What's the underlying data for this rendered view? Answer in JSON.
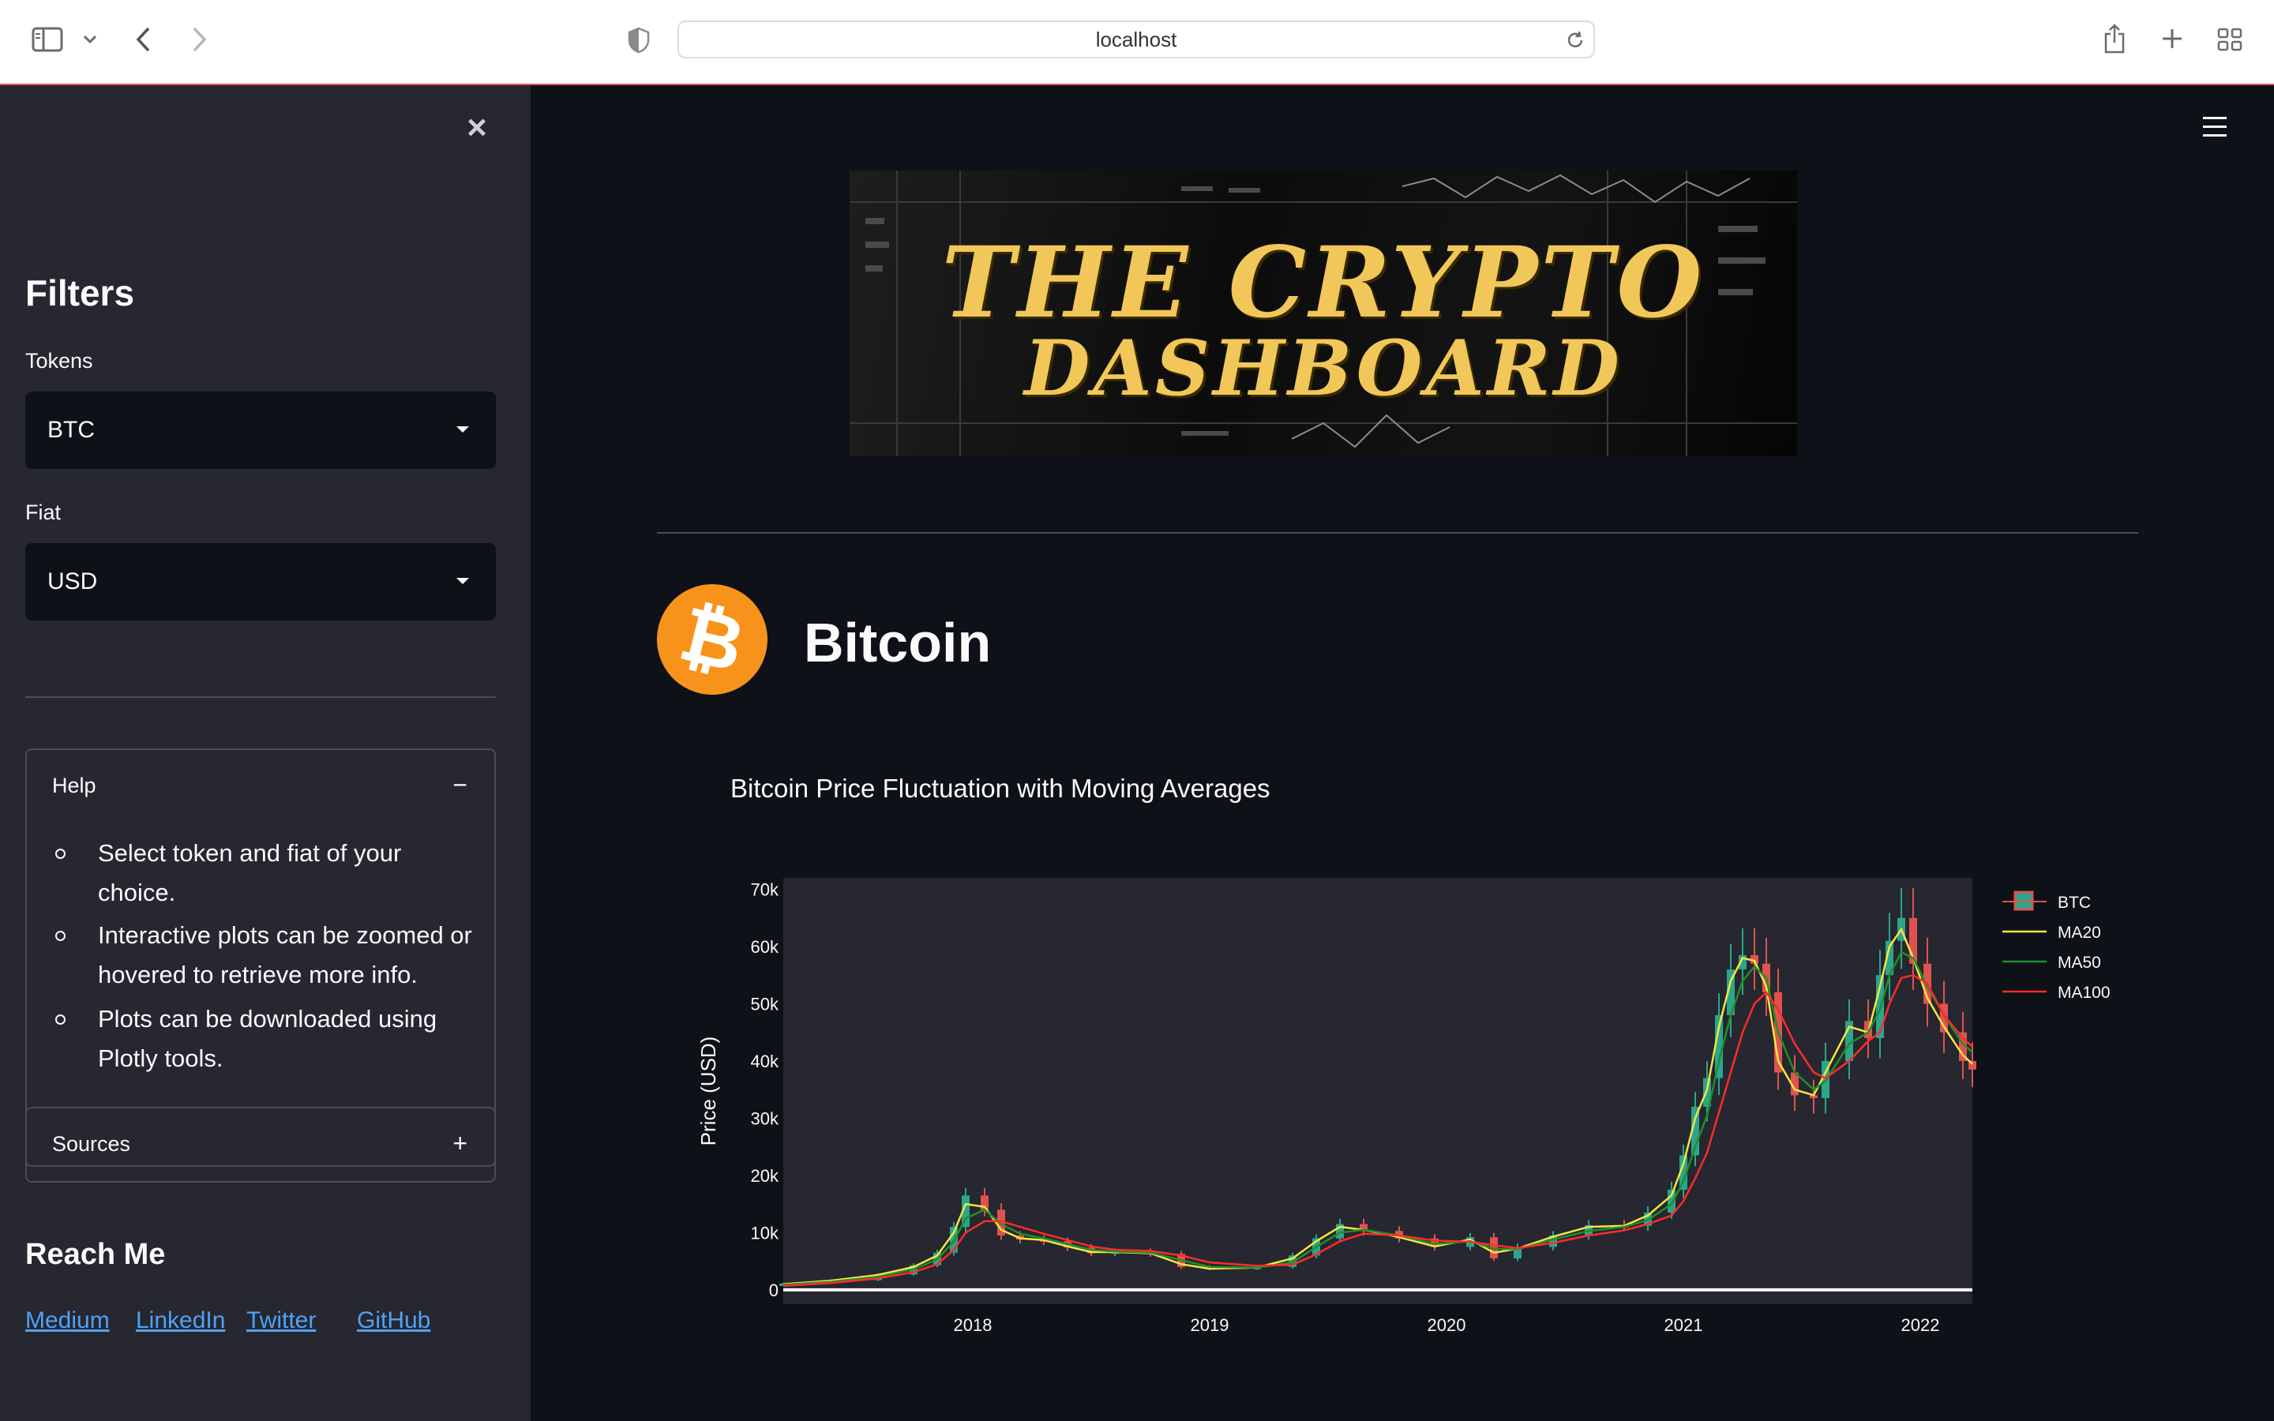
{
  "browser": {
    "url": "localhost"
  },
  "sidebar": {
    "filters_heading": "Filters",
    "tokens_label": "Tokens",
    "tokens_value": "BTC",
    "fiat_label": "Fiat",
    "fiat_value": "USD",
    "help": {
      "title": "Help",
      "toggle": "−",
      "items": [
        "Select token and fiat of your choice.",
        "Interactive plots can be zoomed or hovered to retrieve more info.",
        "Plots can be downloaded using Plotly tools."
      ]
    },
    "sources": {
      "title": "Sources",
      "toggle": "+"
    },
    "reach_heading": "Reach Me",
    "links": [
      "Medium",
      "LinkedIn",
      "Twitter",
      "GitHub"
    ]
  },
  "main": {
    "banner_line1": "THE CRYPTO",
    "banner_line2": "DASHBOARD",
    "coin_symbol": "₿",
    "coin_name": "Bitcoin",
    "chart_title": "Bitcoin Price Fluctuation with Moving Averages"
  },
  "colors": {
    "background": "#0e1117",
    "sidebar": "#262730",
    "plot_bg": "#262730",
    "accent_link": "#4fa2f7",
    "bitcoin_orange": "#f7931a",
    "ma20": "#f5e642",
    "ma50": "#1f8f2a",
    "ma100": "#ff2b2b",
    "candle_up": "#2ca58d",
    "candle_down": "#e0524f"
  },
  "chart_data": {
    "type": "line",
    "title": "Bitcoin Price Fluctuation with Moving Averages",
    "xlabel": "",
    "ylabel": "Price (USD)",
    "x_ticks": [
      "2018",
      "2019",
      "2020",
      "2021",
      "2022"
    ],
    "y_ticks": [
      "0",
      "10k",
      "20k",
      "30k",
      "40k",
      "50k",
      "60k",
      "70k"
    ],
    "xlim": [
      2017.2,
      2022.22
    ],
    "ylim": [
      -2500,
      72000
    ],
    "grid": false,
    "legend": "right",
    "x": [
      2017.2,
      2017.4,
      2017.6,
      2017.75,
      2017.85,
      2017.92,
      2017.97,
      2018.05,
      2018.12,
      2018.2,
      2018.3,
      2018.4,
      2018.5,
      2018.6,
      2018.75,
      2018.88,
      2019.0,
      2019.2,
      2019.35,
      2019.45,
      2019.55,
      2019.65,
      2019.8,
      2019.95,
      2020.1,
      2020.2,
      2020.3,
      2020.45,
      2020.6,
      2020.75,
      2020.85,
      2020.95,
      2021.0,
      2021.05,
      2021.1,
      2021.15,
      2021.2,
      2021.25,
      2021.3,
      2021.35,
      2021.4,
      2021.47,
      2021.55,
      2021.6,
      2021.7,
      2021.78,
      2021.83,
      2021.87,
      2021.92,
      2021.97,
      2022.03,
      2022.1,
      2022.18,
      2022.22
    ],
    "series": [
      {
        "name": "BTC",
        "values": [
          1100,
          1700,
          2700,
          4300,
          6500,
          11000,
          16500,
          14000,
          9500,
          8800,
          8500,
          7400,
          6400,
          6700,
          6300,
          4000,
          3800,
          4000,
          6000,
          9000,
          11500,
          10300,
          9000,
          7500,
          9200,
          5500,
          7500,
          9500,
          11300,
          11200,
          13500,
          17500,
          23500,
          32000,
          37000,
          48000,
          56000,
          58500,
          57000,
          52000,
          38000,
          34000,
          33500,
          40000,
          47000,
          44000,
          55000,
          61000,
          65000,
          57000,
          50000,
          45000,
          40000,
          38500
        ]
      },
      {
        "name": "MA20",
        "values": [
          1000,
          1600,
          2600,
          4000,
          6000,
          10000,
          15000,
          14500,
          10500,
          9000,
          8700,
          7600,
          6600,
          6600,
          6400,
          4500,
          3700,
          3900,
          5500,
          8500,
          11000,
          10500,
          9200,
          7600,
          8800,
          6500,
          7200,
          9300,
          11000,
          11200,
          13000,
          16500,
          22000,
          30000,
          35000,
          46000,
          54000,
          58000,
          57500,
          53000,
          40000,
          35000,
          34000,
          38000,
          46000,
          45000,
          53000,
          60000,
          63000,
          58000,
          51000,
          46000,
          41000,
          39500
        ]
      },
      {
        "name": "MA50",
        "values": [
          900,
          1400,
          2300,
          3600,
          5300,
          8500,
          12500,
          14000,
          11500,
          9800,
          9000,
          8000,
          7000,
          6700,
          6500,
          5200,
          4000,
          3900,
          4800,
          7500,
          10000,
          10500,
          9500,
          8000,
          8500,
          7200,
          7100,
          8800,
          10300,
          11000,
          12200,
          15000,
          19000,
          25000,
          30500,
          40000,
          48000,
          54000,
          56500,
          54500,
          45000,
          38000,
          35000,
          36500,
          43000,
          45000,
          49000,
          55000,
          59000,
          58000,
          53000,
          48000,
          43000,
          41500
        ]
      },
      {
        "name": "MA100",
        "values": [
          700,
          1200,
          2000,
          3100,
          4500,
          7000,
          10000,
          12000,
          12000,
          11000,
          9800,
          8700,
          7600,
          7000,
          6800,
          6000,
          4800,
          4200,
          4400,
          6200,
          8500,
          9800,
          9500,
          8600,
          8400,
          7800,
          7300,
          8200,
          9500,
          10400,
          11500,
          13000,
          15500,
          19500,
          24000,
          31000,
          38000,
          45000,
          50000,
          52000,
          49000,
          43000,
          38000,
          37000,
          40000,
          43500,
          45000,
          50000,
          54500,
          55000,
          53500,
          48000,
          44000,
          42500
        ]
      }
    ]
  }
}
